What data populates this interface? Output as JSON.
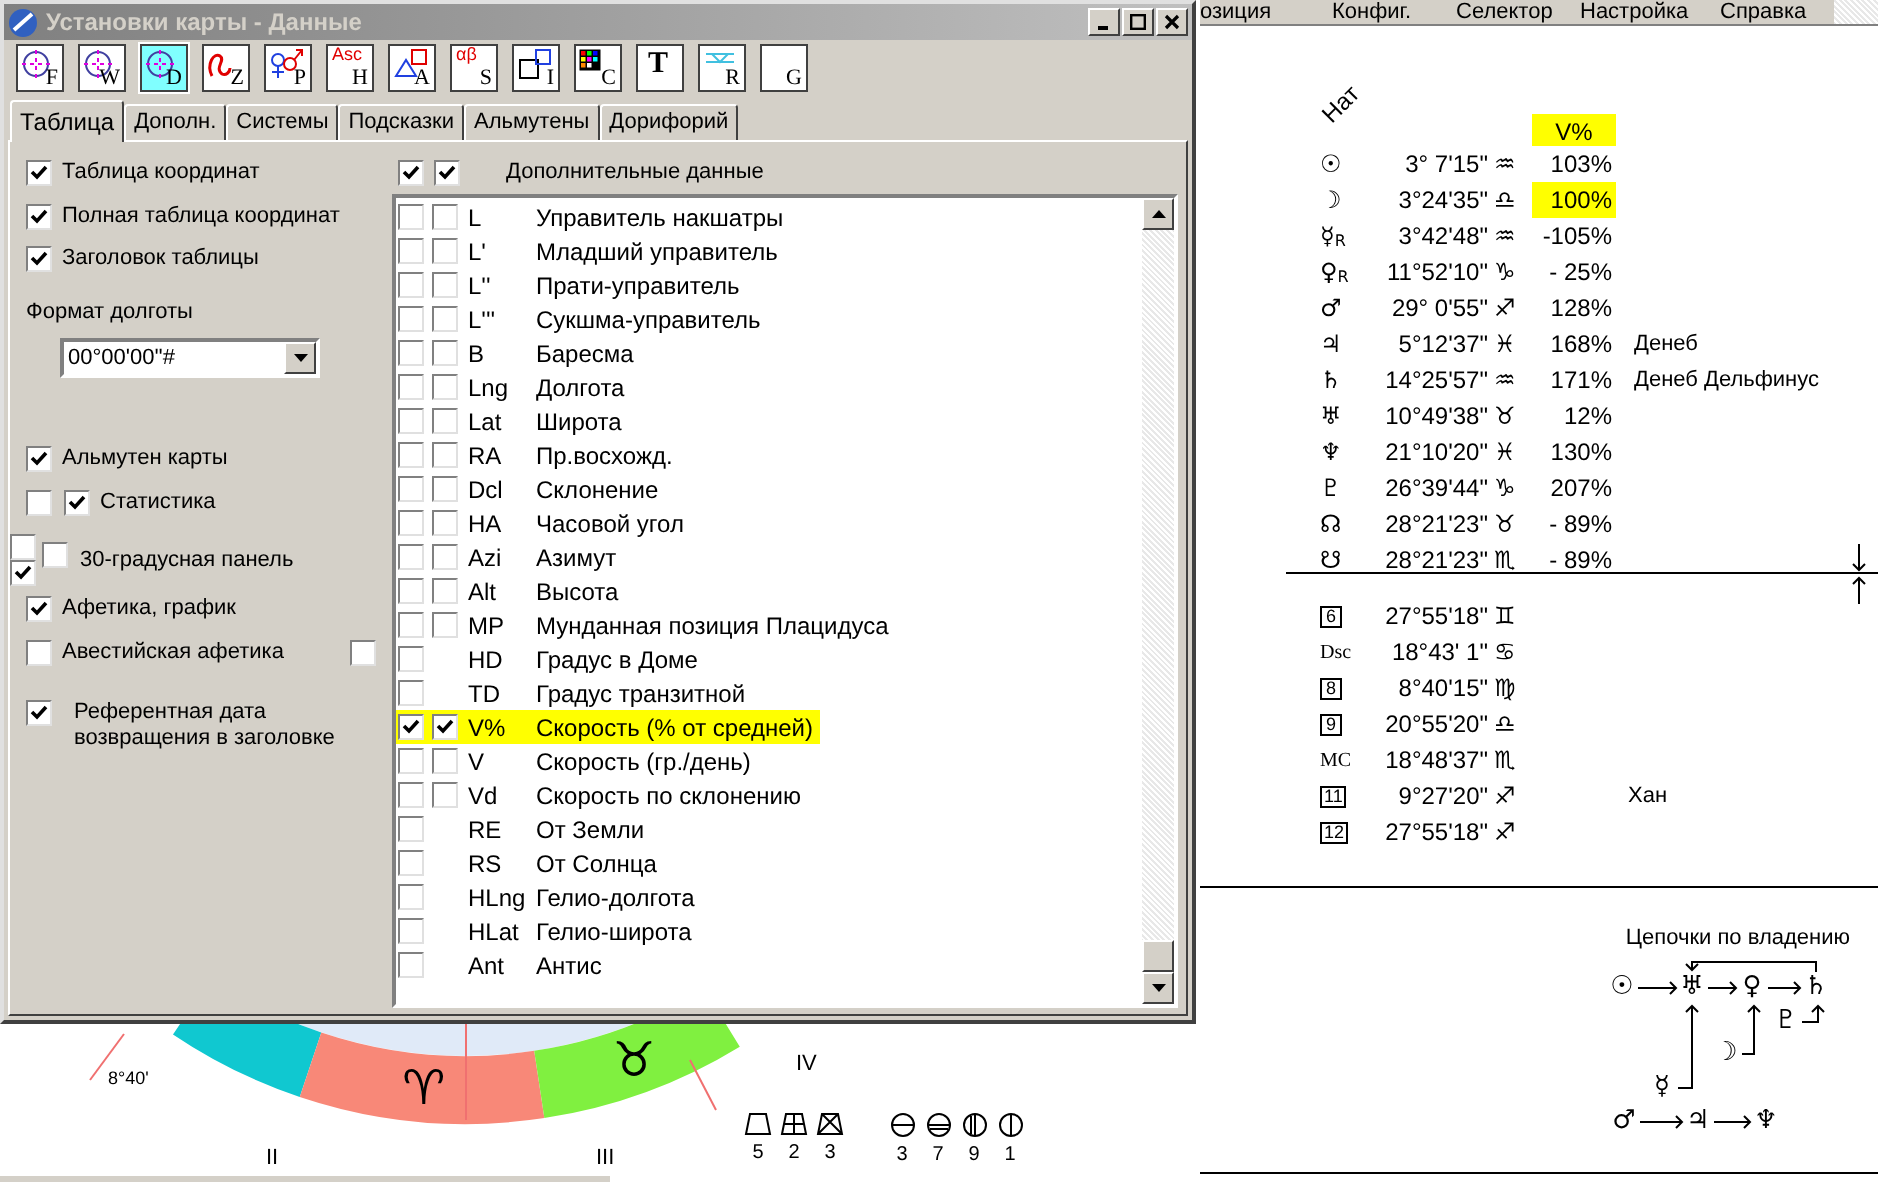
{
  "dialog": {
    "title": "Установки карты - Данные",
    "toolbar": [
      {
        "kind": "circle",
        "sub": "F",
        "selected": false
      },
      {
        "kind": "circle",
        "sub": "W",
        "selected": false
      },
      {
        "kind": "circle",
        "sub": "D",
        "selected": true
      },
      {
        "kind": "snake",
        "sub": "Z",
        "selected": false
      },
      {
        "kind": "planets",
        "sub": "P",
        "selected": false
      },
      {
        "kind": "text",
        "top": "Asc",
        "sub": "H",
        "selected": false
      },
      {
        "kind": "shapes",
        "sub": "A",
        "selected": false
      },
      {
        "kind": "text",
        "top": "αβ",
        "sub": "S",
        "selected": false
      },
      {
        "kind": "boxes",
        "sub": "I",
        "selected": false
      },
      {
        "kind": "grid",
        "sub": "C",
        "selected": false
      },
      {
        "kind": "bold",
        "top": "T",
        "selected": false
      },
      {
        "kind": "lines",
        "sub": "R",
        "selected": false
      },
      {
        "kind": "blank",
        "sub": "G",
        "selected": false
      }
    ],
    "tabs": [
      {
        "label": "Таблица",
        "selected": true
      },
      {
        "label": "Дополн.",
        "selected": false
      },
      {
        "label": "Системы",
        "selected": false
      },
      {
        "label": "Подсказки",
        "selected": false
      },
      {
        "label": "Альмутены",
        "selected": false
      },
      {
        "label": "Дорифорий",
        "selected": false
      }
    ],
    "options": [
      {
        "kind": "check",
        "label": "Таблица координат",
        "checks": [
          true
        ]
      },
      {
        "kind": "check",
        "label": "Полная таблица координат",
        "checks": [
          true
        ]
      },
      {
        "kind": "check",
        "label": "Заголовок таблицы",
        "checks": [
          true
        ]
      },
      {
        "kind": "label",
        "label": "Формат долготы"
      },
      {
        "kind": "dropdown",
        "value": "00°00'00''#"
      },
      {
        "kind": "check",
        "label": "Альмутен карты",
        "checks": [
          true
        ]
      },
      {
        "kind": "check",
        "label": "Статистика",
        "checks": [
          false,
          true
        ]
      },
      {
        "kind": "stacked",
        "label": "30-градусная панель",
        "checks": [
          false,
          true,
          false
        ]
      },
      {
        "kind": "check",
        "label": "Афетика, график",
        "checks": [
          true
        ]
      },
      {
        "kind": "check",
        "label": "Авестийская афетика",
        "checks": [
          false
        ],
        "trailing": false
      },
      {
        "kind": "check",
        "label": "Референтная дата возвращения в заголовке",
        "checks": [
          true
        ]
      }
    ],
    "list_header": {
      "checks": [
        true,
        true
      ],
      "label": "Дополнительные данные"
    },
    "rows": [
      {
        "code": "L",
        "label": "Управитель накшатры",
        "checks": [
          false,
          false
        ],
        "highlighted": false
      },
      {
        "code": "L'",
        "label": "Младший управитель",
        "checks": [
          false,
          false
        ],
        "highlighted": false
      },
      {
        "code": "L''",
        "label": "Прати-управитель",
        "checks": [
          false,
          false
        ],
        "highlighted": false
      },
      {
        "code": "L'''",
        "label": "Сукшма-управитель",
        "checks": [
          false,
          false
        ],
        "highlighted": false
      },
      {
        "code": "B",
        "label": "Баресма",
        "checks": [
          false,
          false
        ],
        "highlighted": false
      },
      {
        "code": "Lng",
        "label": "Долгота",
        "checks": [
          false,
          false
        ],
        "highlighted": false
      },
      {
        "code": "Lat",
        "label": "Широта",
        "checks": [
          false,
          false
        ],
        "highlighted": false
      },
      {
        "code": "RA",
        "label": "Пр.восхожд.",
        "checks": [
          false,
          false
        ],
        "highlighted": false
      },
      {
        "code": "Dcl",
        "label": "Склонение",
        "checks": [
          false,
          false
        ],
        "highlighted": false
      },
      {
        "code": "HA",
        "label": "Часовой угол",
        "checks": [
          false,
          false
        ],
        "highlighted": false
      },
      {
        "code": "Azi",
        "label": "Азимут",
        "checks": [
          false,
          false
        ],
        "highlighted": false
      },
      {
        "code": "Alt",
        "label": "Высота",
        "checks": [
          false,
          false
        ],
        "highlighted": false
      },
      {
        "code": "MP",
        "label": "Мунданная позиция Плацидуса",
        "checks": [
          false,
          false
        ],
        "highlighted": false
      },
      {
        "code": "HD",
        "label": "Градус в Доме",
        "checks": [
          false
        ],
        "highlighted": false
      },
      {
        "code": "TD",
        "label": "Градус транзитной",
        "checks": [
          false
        ],
        "highlighted": false
      },
      {
        "code": "V%",
        "label": "Скорость (% от средней)",
        "checks": [
          true,
          true
        ],
        "highlighted": true
      },
      {
        "code": "V",
        "label": "Скорость (гр./день)",
        "checks": [
          false,
          false
        ],
        "highlighted": false
      },
      {
        "code": "Vd",
        "label": "Скорость по склонению",
        "checks": [
          false,
          false
        ],
        "highlighted": false
      },
      {
        "code": "RE",
        "label": "От Земли",
        "checks": [
          false
        ],
        "highlighted": false
      },
      {
        "code": "RS",
        "label": "От Солнца",
        "checks": [
          false
        ],
        "highlighted": false
      },
      {
        "code": "HLng",
        "label": "Гелио-долгота",
        "checks": [
          false
        ],
        "highlighted": false
      },
      {
        "code": "HLat",
        "label": "Гелио-широта",
        "checks": [
          false
        ],
        "highlighted": false
      },
      {
        "code": "Ant",
        "label": "Антис",
        "checks": [
          false
        ],
        "highlighted": false
      }
    ]
  },
  "menu": [
    "озиция",
    "Конфиг.",
    "Селектор",
    "Настройка",
    "Справка"
  ],
  "planets": {
    "chart_label": "Нат",
    "speed_header": "V%",
    "speed_header_highlighted": true,
    "rows": [
      {
        "glyph": "☉",
        "position": "3° 7'15\"",
        "sign": "♒",
        "speed": "103%",
        "highlighted": false
      },
      {
        "glyph": "☽",
        "position": "3°24'35\"",
        "sign": "♎",
        "speed": "100%",
        "highlighted": true
      },
      {
        "glyph": "☿",
        "retro": "R",
        "position": "3°42'48\"",
        "sign": "♒",
        "speed": "-105%",
        "highlighted": false
      },
      {
        "glyph": "♀",
        "retro": "R",
        "position": "11°52'10\"",
        "sign": "♑",
        "speed": "- 25%",
        "highlighted": false
      },
      {
        "glyph": "♂",
        "position": "29° 0'55\"",
        "sign": "♐",
        "speed": "128%",
        "highlighted": false
      },
      {
        "glyph": "♃",
        "position": "5°12'37\"",
        "sign": "♓",
        "speed": "168%",
        "star": "Денеб",
        "highlighted": false
      },
      {
        "glyph": "♄",
        "position": "14°25'57\"",
        "sign": "♒",
        "speed": "171%",
        "star": "Денеб Дельфинус",
        "highlighted": false
      },
      {
        "glyph": "♅",
        "position": "10°49'38\"",
        "sign": "♉",
        "speed": "12%",
        "highlighted": false
      },
      {
        "glyph": "♆",
        "position": "21°10'20\"",
        "sign": "♓",
        "speed": "130%",
        "highlighted": false
      },
      {
        "glyph": "♇",
        "position": "26°39'44\"",
        "sign": "♑",
        "speed": "207%",
        "highlighted": false
      },
      {
        "glyph": "☊",
        "position": "28°21'23\"",
        "sign": "♉",
        "speed": "- 89%",
        "highlighted": false
      },
      {
        "glyph": "☋",
        "position": "28°21'23\"",
        "sign": "♏",
        "speed": "- 89%",
        "highlighted": false
      }
    ]
  },
  "houses": [
    {
      "kind": "box",
      "label": "6",
      "position": "27°55'18\"",
      "sign": "♊"
    },
    {
      "kind": "text",
      "label": "Dsc",
      "position": "18°43' 1\"",
      "sign": "♋"
    },
    {
      "kind": "box",
      "label": "8",
      "position": "8°40'15\"",
      "sign": "♍"
    },
    {
      "kind": "box",
      "label": "9",
      "position": "20°55'20\"",
      "sign": "♎"
    },
    {
      "kind": "text",
      "label": "MC",
      "position": "18°48'37\"",
      "sign": "♏"
    },
    {
      "kind": "box",
      "label": "11",
      "position": "9°27'20\"",
      "sign": "♐",
      "note": "Хан"
    },
    {
      "kind": "box",
      "label": "12",
      "position": "27°55'18\"",
      "sign": "♐"
    }
  ],
  "chains": {
    "title": "Цепочки по владению",
    "main": [
      "☉",
      "♅",
      "♀",
      "♄"
    ],
    "feeders": [
      "♇",
      "☽",
      "☿"
    ],
    "bottom": [
      "♂",
      "♃",
      "♆"
    ]
  },
  "wheel": {
    "segments": [
      {
        "color": "#10c8d0"
      },
      {
        "color": "#f88878",
        "glyph": "♈"
      },
      {
        "color": "#80f040",
        "glyph": "♉"
      }
    ],
    "degree_label": "8°40'",
    "house_labels": [
      "IV",
      "II",
      "III"
    ]
  },
  "stats": [
    {
      "kind": "trapezoid",
      "value": "5"
    },
    {
      "kind": "trapezoid-grid",
      "value": "2"
    },
    {
      "kind": "trapezoid-cross",
      "value": "3"
    },
    {
      "kind": "circle-top",
      "value": "3"
    },
    {
      "kind": "circle-bottom",
      "value": "7"
    },
    {
      "kind": "circle-left",
      "value": "9"
    },
    {
      "kind": "circle-right",
      "value": "1"
    }
  ]
}
